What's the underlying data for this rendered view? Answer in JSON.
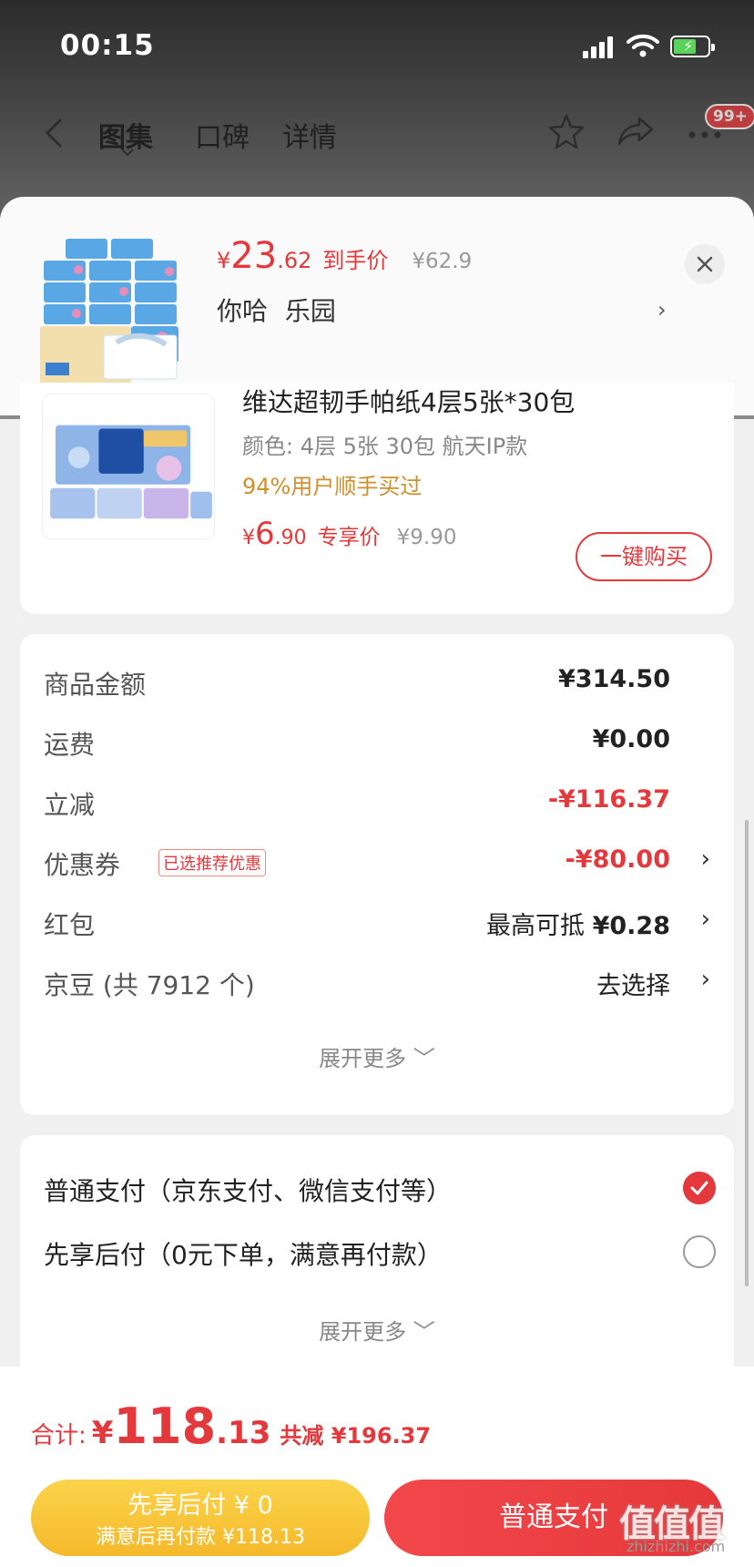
{
  "status_bar": {
    "time": "00:15"
  },
  "nav": {
    "tabs": [
      {
        "label": "图集",
        "active": true
      },
      {
        "label": "口碑",
        "active": false
      },
      {
        "label": "详情",
        "active": false
      }
    ],
    "more_badge": "99+"
  },
  "popup": {
    "price_symbol": "¥",
    "price_int": "23",
    "price_dec": ".62",
    "price_label": "到手价",
    "original_price": "¥62.9",
    "shop_name": "你哈 乐园"
  },
  "recommend": {
    "title": "维达超韧手帕纸4层5张*30包",
    "spec": "颜色: 4层 5张 30包 航天IP款",
    "tagline": "94%用户顺手买过",
    "price_symbol": "¥",
    "price_int": "6",
    "price_dec": ".90",
    "price_label": "专享价",
    "original_price": "¥9.90",
    "buy_label": "一键购买"
  },
  "summary": {
    "rows": [
      {
        "label": "商品金额",
        "value": "¥314.50"
      },
      {
        "label": "运费",
        "value": "¥0.00"
      },
      {
        "label": "立减",
        "value": "-¥116.37"
      },
      {
        "label": "优惠券",
        "tag": "已选推荐优惠",
        "value": "-¥80.00"
      },
      {
        "label": "红包",
        "value_prefix": "最高可抵",
        "value": "¥0.28"
      },
      {
        "label": "京豆 (共 7912 个)",
        "value": "去选择"
      }
    ],
    "expand_label": "展开更多 ﹀"
  },
  "payment": {
    "options": [
      {
        "label": "普通支付（京东支付、微信支付等）",
        "selected": true
      },
      {
        "label": "先享后付（0元下单，满意再付款）",
        "selected": false
      }
    ],
    "expand_label": "展开更多 ﹀"
  },
  "footer": {
    "total_label": "合计:",
    "total_symbol": "¥",
    "total_int": "118",
    "total_dec": ".13",
    "savings": "共减 ¥196.37",
    "later_line1": "先享后付 ¥ 0",
    "later_line2": "满意后再付款 ¥118.13",
    "pay_label": "普通支付",
    "watermark": "值值值",
    "watermark_url": "zhizhizhi.com"
  },
  "colors": {
    "accent": "#e4393c",
    "gold": "#f5b92b"
  }
}
